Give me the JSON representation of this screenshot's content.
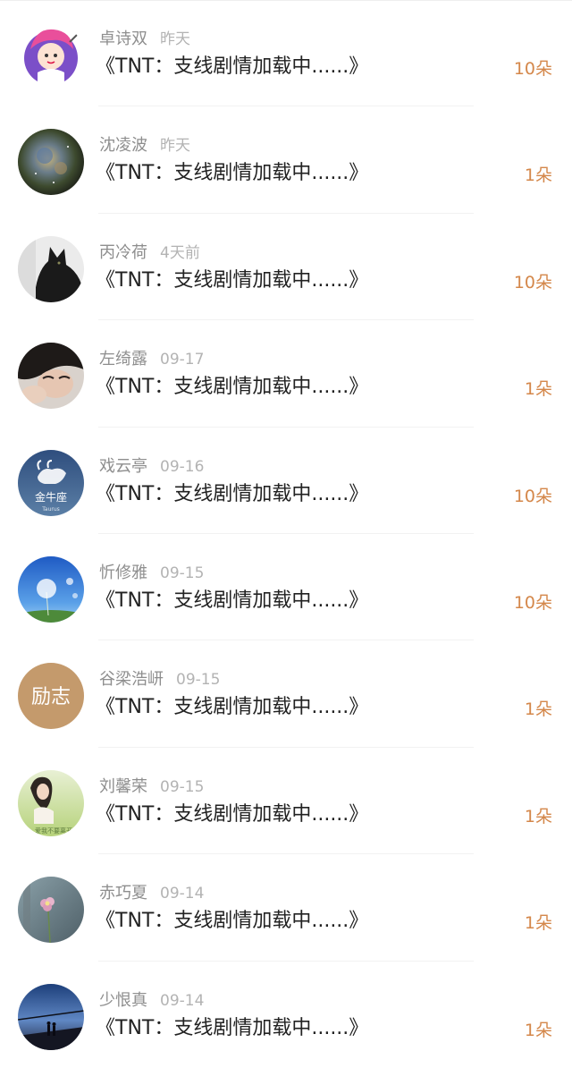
{
  "accent_color": "#d4874a",
  "items": [
    {
      "name": "卓诗双",
      "time": "昨天",
      "message": "《TNT：支线剧情加载中......》",
      "count": "10朵",
      "avatar": "cartoon-girl-avatar"
    },
    {
      "name": "沈凌波",
      "time": "昨天",
      "message": "《TNT：支线剧情加载中......》",
      "count": "1朵",
      "avatar": "nebula-avatar"
    },
    {
      "name": "丙冷荷",
      "time": "4天前",
      "message": "《TNT：支线剧情加载中......》",
      "count": "10朵",
      "avatar": "black-cat-avatar"
    },
    {
      "name": "左绮露",
      "time": "09-17",
      "message": "《TNT：支线剧情加载中......》",
      "count": "1朵",
      "avatar": "girl-face-avatar"
    },
    {
      "name": "戏云亭",
      "time": "09-16",
      "message": "《TNT：支线剧情加载中......》",
      "count": "10朵",
      "avatar": "taurus-avatar"
    },
    {
      "name": "忻修雅",
      "time": "09-15",
      "message": "《TNT：支线剧情加载中......》",
      "count": "10朵",
      "avatar": "dandelion-sky-avatar"
    },
    {
      "name": "谷梁浩岍",
      "time": "09-15",
      "message": "《TNT：支线剧情加载中......》",
      "count": "1朵",
      "avatar": "text-badge-avatar"
    },
    {
      "name": "刘馨荣",
      "time": "09-15",
      "message": "《TNT：支线剧情加载中......》",
      "count": "1朵",
      "avatar": "girl-garden-avatar"
    },
    {
      "name": "赤巧夏",
      "time": "09-14",
      "message": "《TNT：支线剧情加载中......》",
      "count": "1朵",
      "avatar": "flower-avatar"
    },
    {
      "name": "少恨真",
      "time": "09-14",
      "message": "《TNT：支线剧情加载中......》",
      "count": "1朵",
      "avatar": "couple-silhouette-avatar"
    }
  ],
  "avatar_labels": {
    "taurus": "金牛座",
    "taurus_sub": "Taurus",
    "badge": "励志",
    "garden": "爱我不要离开"
  }
}
